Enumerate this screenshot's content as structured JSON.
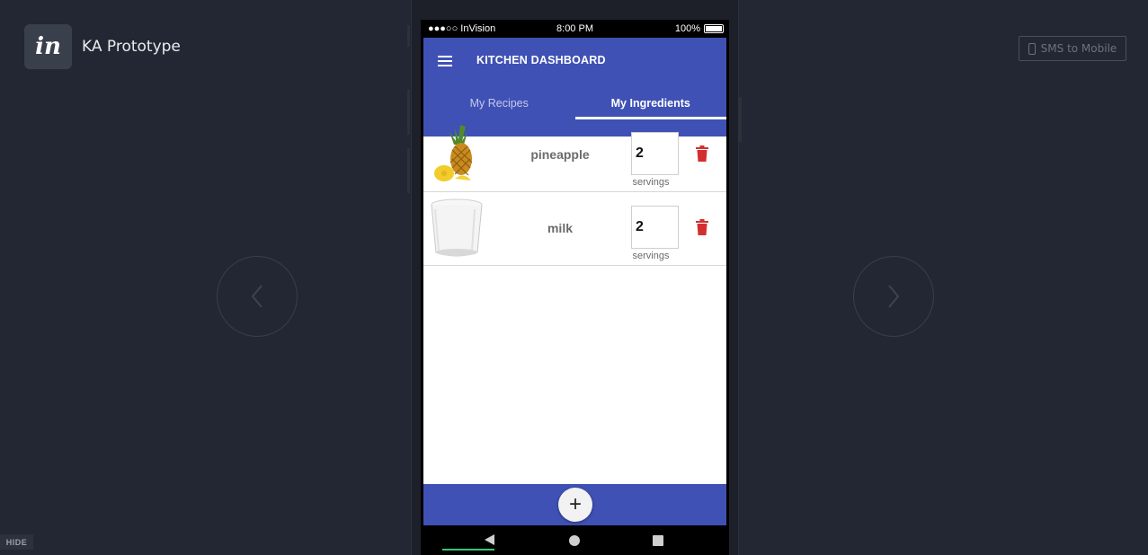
{
  "workspace": {
    "logo_text": "in",
    "title": "KA Prototype",
    "sms_label": "SMS to Mobile",
    "hide_label": "HIDE",
    "prev_icon": "chevron-left-icon",
    "next_icon": "chevron-right-icon"
  },
  "device": {
    "status": {
      "carrier": "●●●○○ InVision",
      "time": "8:00 PM",
      "battery": "100%"
    }
  },
  "app": {
    "title": "KITCHEN DASHBOARD",
    "tabs": [
      {
        "label": "My Recipes",
        "active": false
      },
      {
        "label": "My Ingredients",
        "active": true
      }
    ],
    "ingredients": [
      {
        "name": "pineapple",
        "servings": "2",
        "unit": "servings",
        "image": "pineapple-image"
      },
      {
        "name": "milk",
        "servings": "2",
        "unit": "servings",
        "image": "milk-glass-image"
      }
    ],
    "add_label": "+"
  },
  "colors": {
    "primary": "#3f51b5",
    "delete": "#d32f2f",
    "background": "#232733"
  }
}
